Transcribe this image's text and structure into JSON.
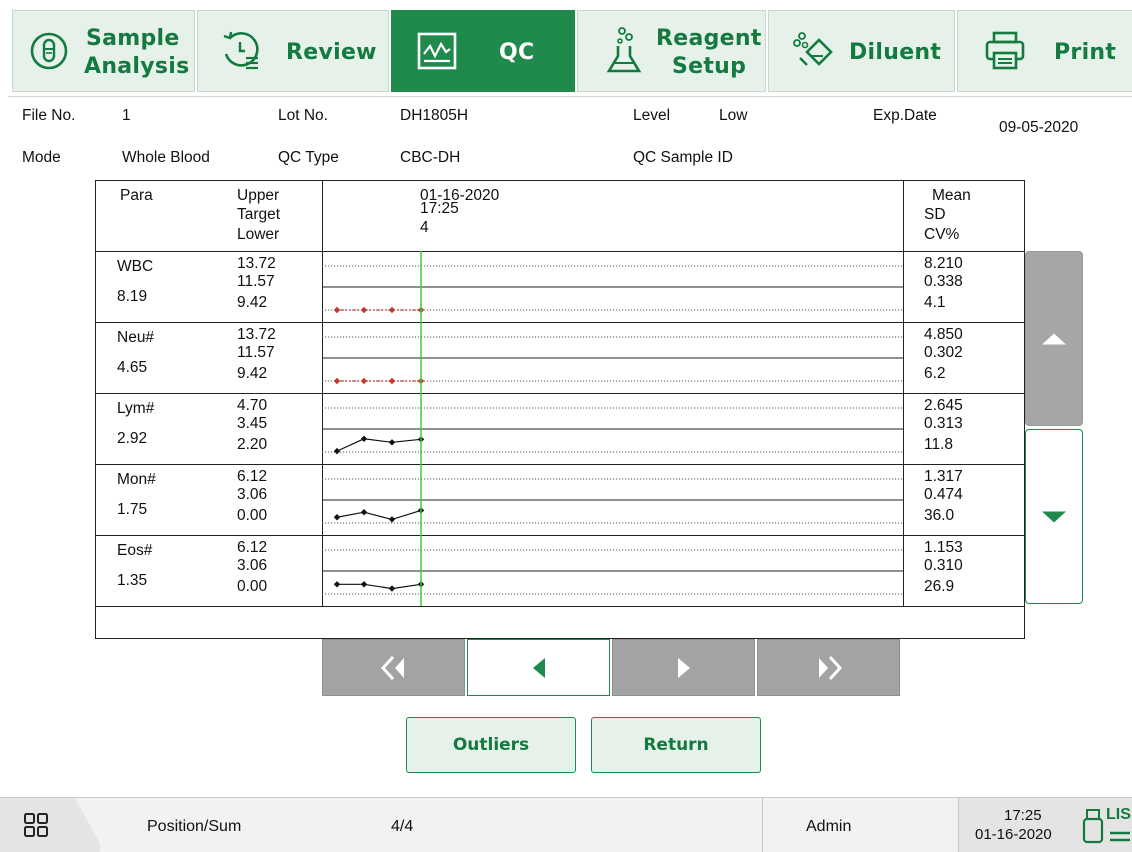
{
  "tabs": [
    {
      "label": "Sample Analysis",
      "line1": "Sample",
      "line2": "Analysis",
      "icon": "test-tube-icon",
      "active": false
    },
    {
      "label": "Review",
      "icon": "review-history-icon",
      "active": false
    },
    {
      "label": "QC",
      "icon": "qc-chart-icon",
      "active": true
    },
    {
      "label": "Reagent Setup",
      "line1": "Reagent",
      "line2": "Setup",
      "icon": "flask-icon",
      "active": false
    },
    {
      "label": "Diluent",
      "icon": "diluent-icon",
      "active": false
    },
    {
      "label": "Print",
      "icon": "printer-icon",
      "active": false
    }
  ],
  "info": {
    "file_no_label": "File No.",
    "file_no": "1",
    "lot_no_label": "Lot No.",
    "lot_no": "DH1805H",
    "level_label": "Level",
    "level": "Low",
    "exp_date_label": "Exp.Date",
    "exp_date": "09-05-2020",
    "mode_label": "Mode",
    "mode": "Whole Blood",
    "qc_type_label": "QC Type",
    "qc_type": "CBC-DH",
    "qc_sample_id_label": "QC Sample ID"
  },
  "table_header": {
    "para": "Para",
    "limits": [
      "Upper",
      "Target",
      "Lower"
    ],
    "run_date": "01-16-2020",
    "run_time": "17:25",
    "run_index": "4",
    "stats": [
      "Mean",
      "SD",
      "CV%"
    ]
  },
  "parameters": [
    {
      "name": "WBC",
      "current": "8.19",
      "upper": "13.72",
      "target": "11.57",
      "lower": "9.42",
      "mean": "8.210",
      "sd": "0.338",
      "cv": "4.1",
      "out_of_range": true,
      "points": [
        9.42,
        9.42,
        9.42,
        9.42
      ]
    },
    {
      "name": "Neu#",
      "current": "4.65",
      "upper": "13.72",
      "target": "11.57",
      "lower": "9.42",
      "mean": "4.850",
      "sd": "0.302",
      "cv": "6.2",
      "out_of_range": true,
      "points": [
        9.42,
        9.42,
        9.42,
        9.42
      ]
    },
    {
      "name": "Lym#",
      "current": "2.92",
      "upper": "4.70",
      "target": "3.45",
      "lower": "2.20",
      "mean": "2.645",
      "sd": "0.313",
      "cv": "11.8",
      "out_of_range": false,
      "points": [
        2.25,
        2.95,
        2.75,
        2.92
      ]
    },
    {
      "name": "Mon#",
      "current": "1.75",
      "upper": "6.12",
      "target": "3.06",
      "lower": "0.00",
      "mean": "1.317",
      "sd": "0.474",
      "cv": "36.0",
      "out_of_range": false,
      "points": [
        0.8,
        1.5,
        0.5,
        1.75
      ]
    },
    {
      "name": "Eos#",
      "current": "1.35",
      "upper": "6.12",
      "target": "3.06",
      "lower": "0.00",
      "mean": "1.153",
      "sd": "0.310",
      "cv": "26.9",
      "out_of_range": false,
      "points": [
        1.35,
        1.35,
        0.75,
        1.35
      ]
    }
  ],
  "colors": {
    "accent": "#1f8a4c",
    "out_of_range": "#c0392b",
    "cursor": "#35d035",
    "point": "#111111"
  },
  "nav": {
    "first": "first-page-icon",
    "prev": "prev-icon",
    "next": "next-icon",
    "last": "last-page-icon"
  },
  "actions": {
    "outliers": "Outliers",
    "return": "Return"
  },
  "status": {
    "position_label": "Position/Sum",
    "position_value": "4/4",
    "user": "Admin",
    "time": "17:25",
    "date": "01-16-2020",
    "lis_label": "LIS"
  }
}
